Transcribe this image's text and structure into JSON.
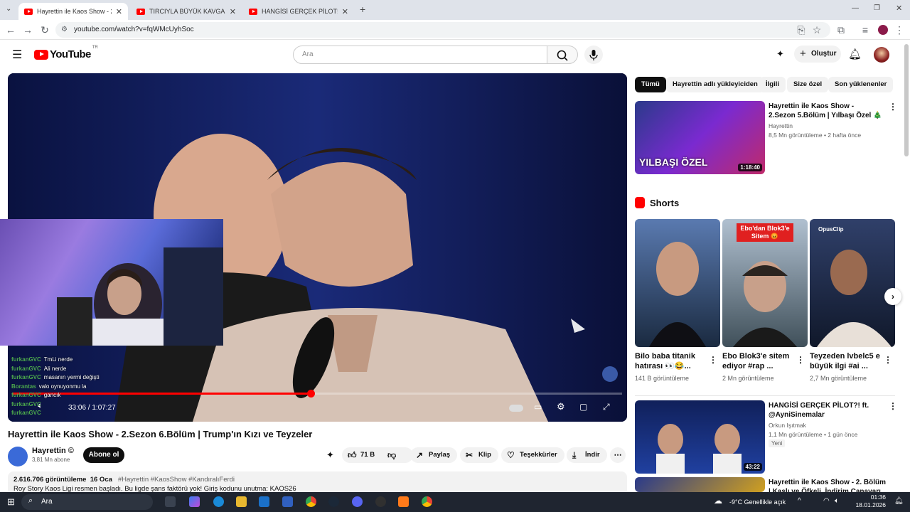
{
  "browser": {
    "tabs": [
      {
        "label": "Hayrettin ile Kaos Show - 2.Sezon",
        "active": true
      },
      {
        "label": "TIRCIYLA BÜYÜK KAVGA! Türkiy",
        "active": false
      },
      {
        "label": "HANGİSİ GERÇEK PİLOT!? ft. @ay",
        "active": false
      }
    ],
    "new_tab": "+",
    "url": "youtube.com/watch?v=fqWMcUyhSoc"
  },
  "youtube": {
    "logo_text": "YouTube",
    "country_code": "TR",
    "search_placeholder": "Ara",
    "create_label": "Oluştur",
    "accent": "#ff0000"
  },
  "player": {
    "time": "33:06 / 1:07:27",
    "progress": 0.49,
    "chat": [
      {
        "user": "furkanGVC",
        "msg": "TmLi nerde"
      },
      {
        "user": "furkanGVC",
        "msg": "Ali nerde"
      },
      {
        "user": "furkanGVC",
        "msg": "masanın yermi değişti"
      },
      {
        "user": "Borantas",
        "msg": "valo oynuyonmu la"
      },
      {
        "user": "furkanGVC",
        "msg": "gancık"
      },
      {
        "user": "furkanGVC",
        "msg": ""
      },
      {
        "user": "furkanGVC",
        "msg": ""
      }
    ]
  },
  "video": {
    "title": "Hayrettin ile Kaos Show - 2.Sezon 6.Bölüm | Trump'ın Kızı ve Teyzeler",
    "channel": "Hayrettin ©",
    "subscribers": "3,81 Mn abone",
    "subscribe_label": "Abone ol",
    "likes": "71 B",
    "share_label": "Paylaş",
    "clip_label": "Klip",
    "thanks_label": "Teşekkürler",
    "download_label": "İndir",
    "views": "2.616.706 görüntüleme",
    "date": "16 Oca",
    "hashtags": "#Hayrettin #KaosShow #KandıralıFerdi",
    "description": "Roy Story Kaos Ligi resmen başladı. Bu ligde şans faktörü yok! Giriş kodunu unutma: KAOS26"
  },
  "filters": [
    "Tümü",
    "Hayrettin adlı yükleyiciden",
    "İlgili",
    "Size özel",
    "Son yüklenenler"
  ],
  "recommendations": [
    {
      "title": "Hayrettin ile Kaos Show - 2.Sezon 5.Bölüm | Yılbaşı Özel 🎄",
      "channel": "Hayrettin",
      "meta": "8,5 Mn görüntüleme • 2 hafta önce",
      "duration": "1:18:40",
      "thumb_text": "YILBAŞI ÖZEL"
    },
    {
      "title": "HANGİSİ GERÇEK PİLOT?! ft. @AyniSinemalar",
      "channel": "Orkun Işıtmak",
      "meta": "1,1 Mn görüntüleme • 1 gün önce",
      "badge": "Yeni",
      "duration": "43:22"
    },
    {
      "title": "Hayrettin ile Kaos Show - 2. Bölüm | Kaslı ve Öfkeli, İndirim Canavarı",
      "channel": "",
      "meta": "",
      "duration": ""
    }
  ],
  "shorts": {
    "header": "Shorts",
    "items": [
      {
        "title": "Bilo baba titanik hatırası 👀😂...",
        "views": "141 B görüntüleme",
        "overlay": ""
      },
      {
        "title": "Ebo Blok3'e sitem ediyor #rap ...",
        "views": "2 Mn görüntüleme",
        "overlay": "Ebo'dan Blok3'e Sitem 😡"
      },
      {
        "title": "Teyzeden lvbelc5 e büyük ilgi #ai ...",
        "views": "2,7 Mn görüntüleme",
        "overlay": "OpusClip"
      }
    ]
  },
  "taskbar": {
    "search": "Ara",
    "weather": "-9°C  Genellikle açık",
    "time": "01:36",
    "date": "18.01.2026"
  }
}
